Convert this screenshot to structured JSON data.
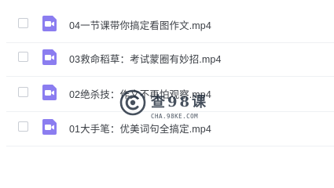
{
  "files": [
    {
      "name": "04一节课带你搞定看图作文.mp4",
      "icon": "video-file-icon"
    },
    {
      "name": "03救命稻草：考试蒙圈有妙招.mp4",
      "icon": "video-file-icon"
    },
    {
      "name": "02绝杀技：作文不再怕观察.mp4",
      "icon": "video-file-icon"
    },
    {
      "name": "01大手笔：优美词句全搞定.mp4",
      "icon": "video-file-icon"
    }
  ],
  "watermark": {
    "title": "查98课",
    "url": "CHA.98KE.COM"
  },
  "colors": {
    "icon_bg": "#8b7df0",
    "icon_glyph": "#ffffff",
    "text": "#3b3f45",
    "checkbox_border": "#c9cdd4",
    "divider": "#eef0f3",
    "watermark": "#1e2a3a"
  }
}
